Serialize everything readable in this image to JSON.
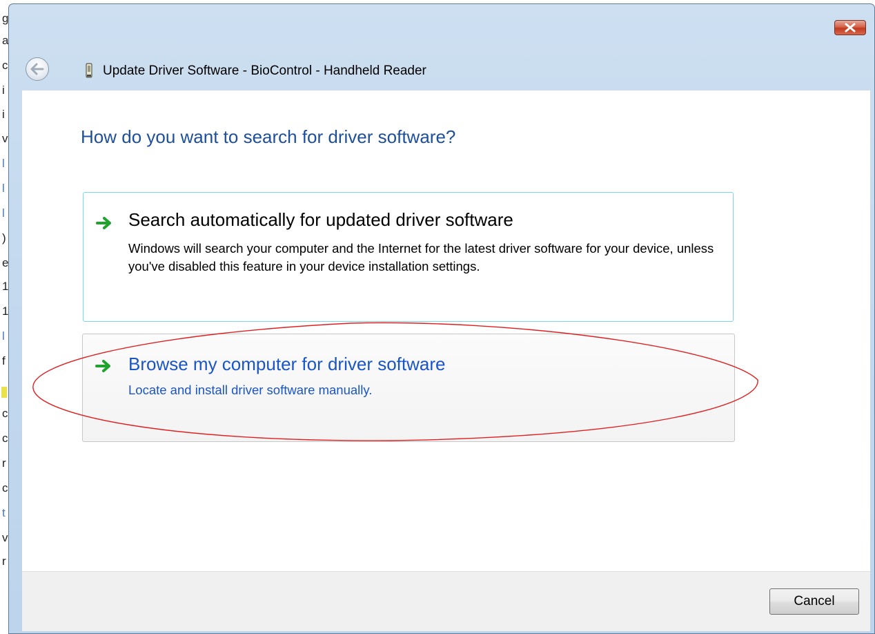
{
  "background_text": [
    "g",
    "a",
    "c",
    "i",
    "i",
    "v",
    "l",
    "l",
    "l",
    ")",
    "e",
    "1",
    "1",
    "l",
    "f",
    "c",
    "c",
    "r",
    "c",
    "t",
    "v",
    "r"
  ],
  "window": {
    "title": "Update Driver Software - BioControl - Handheld Reader",
    "close_icon": "close-icon",
    "back_icon": "back-arrow-icon"
  },
  "dialog": {
    "heading": "How do you want to search for driver software?",
    "options": [
      {
        "title": "Search automatically for updated driver software",
        "description": "Windows will search your computer and the Internet for the latest driver software for your device, unless you've disabled this feature in your device installation settings.",
        "icon": "green-arrow-icon"
      },
      {
        "title": "Browse my computer for driver software",
        "description": "Locate and install driver software manually.",
        "icon": "green-arrow-icon",
        "highlighted": true
      }
    ]
  },
  "footer": {
    "cancel_label": "Cancel"
  },
  "colors": {
    "heading": "#1e4f9c",
    "link": "#1a55c8",
    "annotation": "#e02020",
    "option_hover_border": "#79d6ee"
  }
}
